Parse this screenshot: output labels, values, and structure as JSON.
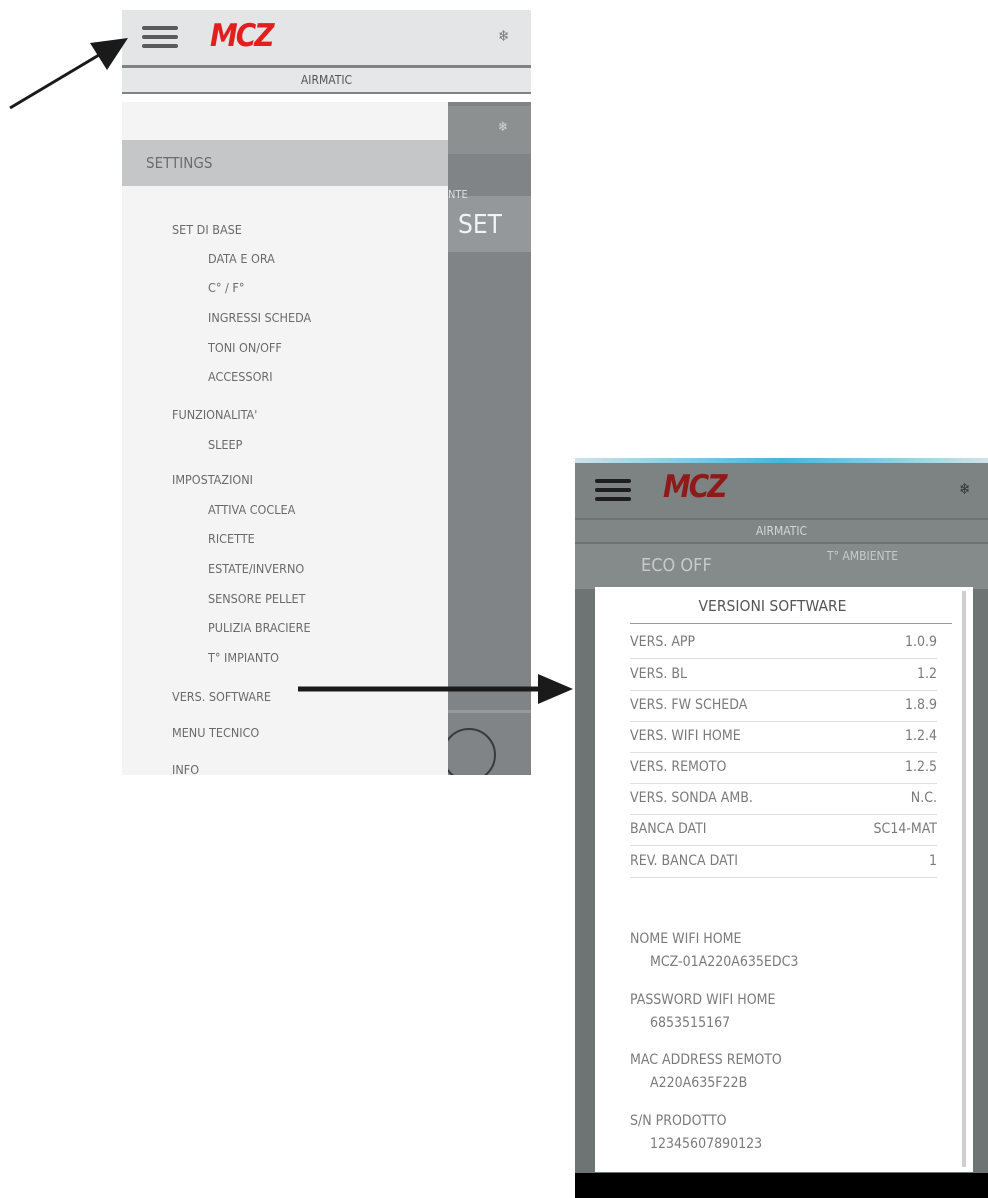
{
  "left_screen": {
    "logo": "MCZ",
    "subtitle": "AIRMATIC",
    "ghost_set": "SET",
    "ghost_nte": "NTE",
    "settings_header": "SETTINGS",
    "menu": [
      {
        "label": "SET DI BASE",
        "level": 0
      },
      {
        "label": "DATA E ORA",
        "level": 1
      },
      {
        "label": "C° / F°",
        "level": 1
      },
      {
        "label": "INGRESSI SCHEDA",
        "level": 1
      },
      {
        "label": "TONI ON/OFF",
        "level": 1
      },
      {
        "label": "ACCESSORI",
        "level": 1
      },
      {
        "label": "FUNZIONALITA'",
        "level": 0
      },
      {
        "label": "SLEEP",
        "level": 1
      },
      {
        "label": "IMPOSTAZIONI",
        "level": 0
      },
      {
        "label": "ATTIVA COCLEA",
        "level": 1
      },
      {
        "label": "RICETTE",
        "level": 1
      },
      {
        "label": "ESTATE/INVERNO",
        "level": 1
      },
      {
        "label": "SENSORE PELLET",
        "level": 1
      },
      {
        "label": "PULIZIA BRACIERE",
        "level": 1
      },
      {
        "label": "T° IMPIANTO",
        "level": 1
      },
      {
        "label": "VERS. SOFTWARE",
        "level": 0
      },
      {
        "label": "MENU TECNICO",
        "level": 0
      },
      {
        "label": "INFO",
        "level": 0
      }
    ]
  },
  "right_screen": {
    "logo": "MCZ",
    "subtitle": "AIRMATIC",
    "eco_label": "ECO OFF",
    "tamb_label": "T° AMBIENTE",
    "dialog": {
      "title": "VERSIONI SOFTWARE",
      "rows": [
        {
          "label": "VERS. APP",
          "value": "1.0.9"
        },
        {
          "label": "VERS. BL",
          "value": "1.2"
        },
        {
          "label": "VERS. FW SCHEDA",
          "value": "1.8.9"
        },
        {
          "label": "VERS. WIFI HOME",
          "value": "1.2.4"
        },
        {
          "label": "VERS. REMOTO",
          "value": "1.2.5"
        },
        {
          "label": "VERS. SONDA AMB.",
          "value": "N.C."
        },
        {
          "label": "BANCA DATI",
          "value": "SC14-MAT"
        },
        {
          "label": "REV. BANCA DATI",
          "value": "1"
        }
      ],
      "info": [
        {
          "label": "NOME WIFI HOME",
          "value": "MCZ-01A220A635EDC3"
        },
        {
          "label": "PASSWORD WIFI HOME",
          "value": "6853515167"
        },
        {
          "label": "MAC ADDRESS REMOTO",
          "value": "A220A635F22B"
        },
        {
          "label": "S/N PRODOTTO",
          "value": "12345607890123"
        }
      ]
    }
  },
  "icons": {
    "menu": "hamburger-icon",
    "fan": "snowflake-icon"
  },
  "colors": {
    "brand_red": "#e41d1d",
    "arrow": "#1a1a1a"
  }
}
